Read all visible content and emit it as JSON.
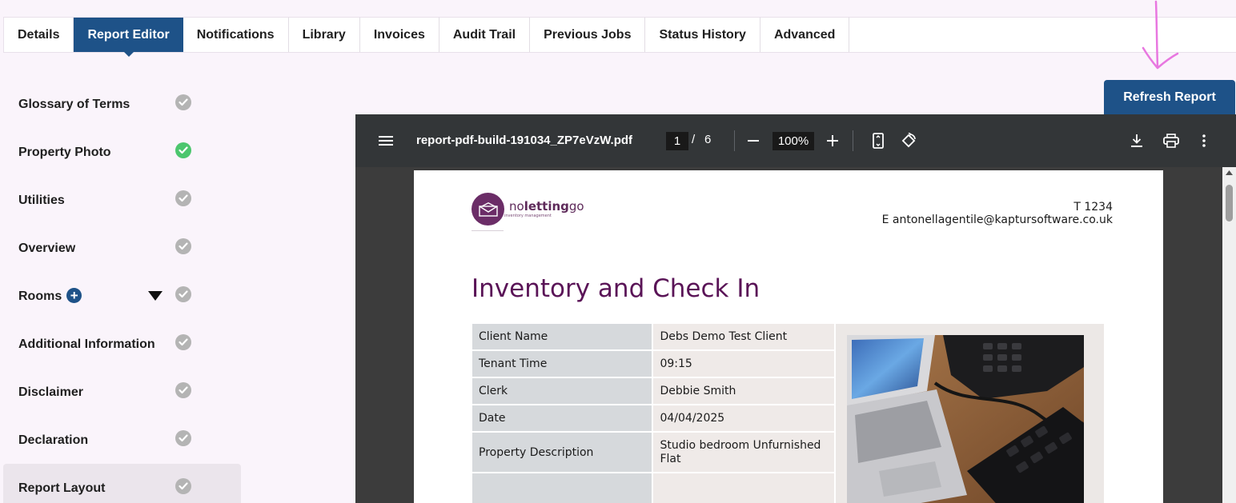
{
  "tabs": [
    {
      "label": "Details",
      "active": false
    },
    {
      "label": "Report Editor",
      "active": true
    },
    {
      "label": "Notifications",
      "active": false
    },
    {
      "label": "Library",
      "active": false
    },
    {
      "label": "Invoices",
      "active": false
    },
    {
      "label": "Audit Trail",
      "active": false
    },
    {
      "label": "Previous Jobs",
      "active": false
    },
    {
      "label": "Status History",
      "active": false
    },
    {
      "label": "Advanced",
      "active": false
    }
  ],
  "sidebar": {
    "items": [
      {
        "label": "Glossary of Terms",
        "complete": false
      },
      {
        "label": "Property Photo",
        "complete": true
      },
      {
        "label": "Utilities",
        "complete": false
      },
      {
        "label": "Overview",
        "complete": false
      },
      {
        "label": "Rooms",
        "complete": false
      },
      {
        "label": "Additional Information",
        "complete": false
      },
      {
        "label": "Disclaimer",
        "complete": false
      },
      {
        "label": "Declaration",
        "complete": false
      },
      {
        "label": "Report Layout",
        "complete": false
      }
    ]
  },
  "refresh_label": "Refresh Report",
  "viewer": {
    "filename": "report-pdf-build-191034_ZP7eVzW.pdf",
    "page_current": "1",
    "page_separator": "/",
    "page_total": "6",
    "zoom": "100%"
  },
  "report": {
    "logo_prefix": "no",
    "logo_bold": "letting",
    "logo_suffix": "go",
    "logo_tagline": "inventory management",
    "phone": "T 1234",
    "email": "E antonellagentile@kaptursoftware.co.uk",
    "title": "Inventory and Check In",
    "rows": [
      {
        "key": "Client Name",
        "value": "Debs Demo Test Client"
      },
      {
        "key": "Tenant Time",
        "value": "09:15"
      },
      {
        "key": "Clerk",
        "value": "Debbie Smith"
      },
      {
        "key": "Date",
        "value": "04/04/2025"
      },
      {
        "key": "Property Description",
        "value": "Studio bedroom Unfurnished Flat"
      },
      {
        "key": "",
        "value": ""
      }
    ]
  },
  "colors": {
    "primary": "#1e5288",
    "complete": "#4cc66e",
    "pending": "#b4b4b4",
    "title_purple": "#5a1457",
    "annotation": "#e877e0"
  }
}
